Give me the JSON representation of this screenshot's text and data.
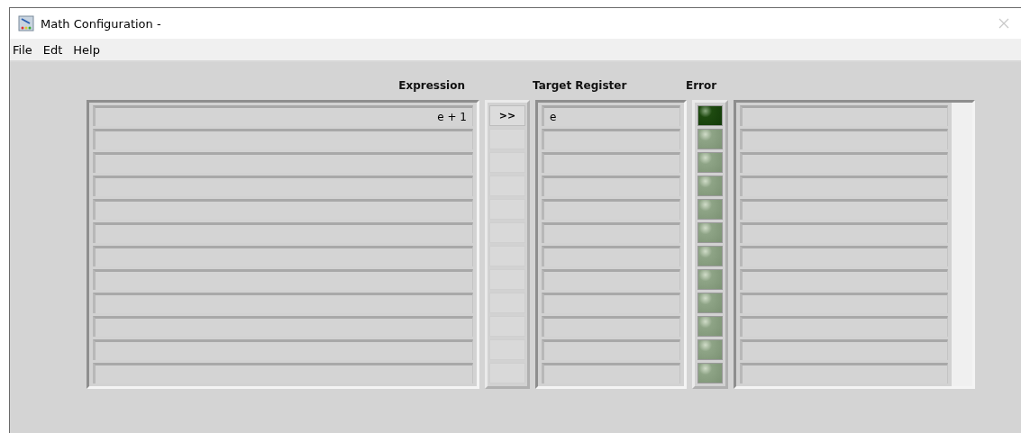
{
  "window": {
    "title": "Math Configuration -"
  },
  "menu": [
    "File",
    "Edt",
    "Help"
  ],
  "columns": {
    "expression": "Expression",
    "target": "Target Register",
    "error": "Error"
  },
  "rows": [
    {
      "expression": "e + 1",
      "action": ">>",
      "target": "e",
      "error": true
    },
    {
      "error": false
    },
    {
      "error": false
    },
    {
      "error": false
    },
    {
      "error": false
    },
    {
      "error": false
    },
    {
      "error": false
    },
    {
      "error": false
    },
    {
      "error": false
    },
    {
      "error": false
    },
    {
      "error": false
    },
    {
      "error": false
    }
  ]
}
